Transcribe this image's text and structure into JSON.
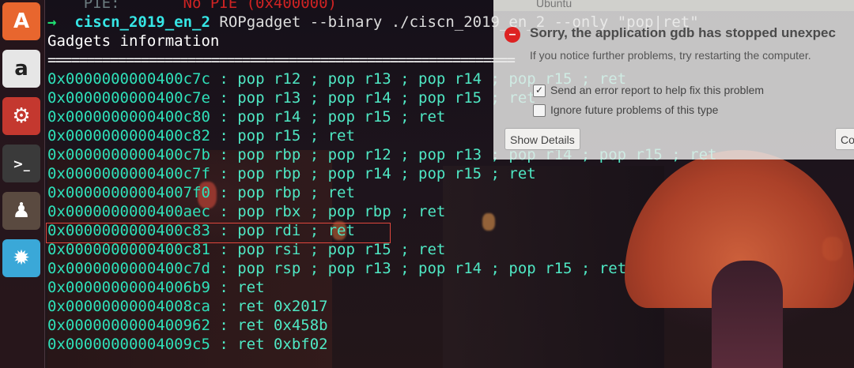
{
  "launcher": {
    "items": [
      {
        "name": "ubuntu-software-center",
        "glyph": "A",
        "color": "#e8662e"
      },
      {
        "name": "amazon",
        "glyph": "a",
        "color": "#e6e6e6"
      },
      {
        "name": "system-settings",
        "glyph": "⚙",
        "color": "#c4382f"
      },
      {
        "name": "terminal",
        "glyph": ">_",
        "color": "#3a3a3a"
      },
      {
        "name": "chess",
        "glyph": "♟",
        "color": "#5a4a40"
      },
      {
        "name": "splash-app",
        "glyph": "✹",
        "color": "#3aa8d8"
      }
    ]
  },
  "terminal": {
    "pie_label": "    PIE:",
    "pie_value": "No PIE (0x400000)",
    "prompt_arrow": "→",
    "prompt_dir": "ciscn_2019_en_2",
    "prompt_cmd": " ROPgadget --binary ./ciscn_2019_en_2 --only \"pop|ret\"",
    "gadgets_header": "Gadgets information",
    "separator": "============================================================",
    "gadgets": [
      {
        "addr": "0x0000000000400c7c",
        "instr": " : pop r12 ; pop r13 ; pop r14 ; pop r15 ; ret"
      },
      {
        "addr": "0x0000000000400c7e",
        "instr": " : pop r13 ; pop r14 ; pop r15 ; ret"
      },
      {
        "addr": "0x0000000000400c80",
        "instr": " : pop r14 ; pop r15 ; ret"
      },
      {
        "addr": "0x0000000000400c82",
        "instr": " : pop r15 ; ret"
      },
      {
        "addr": "0x0000000000400c7b",
        "instr": " : pop rbp ; pop r12 ; pop r13 ; pop r14 ; pop r15 ; ret"
      },
      {
        "addr": "0x0000000000400c7f",
        "instr": " : pop rbp ; pop r14 ; pop r15 ; ret"
      },
      {
        "addr": "0x00000000004007f0",
        "instr": " : pop rbp ; ret"
      },
      {
        "addr": "0x0000000000400aec",
        "instr": " : pop rbx ; pop rbp ; ret"
      },
      {
        "addr": "0x0000000000400c83",
        "instr": " : pop rdi ; ret"
      },
      {
        "addr": "0x0000000000400c81",
        "instr": " : pop rsi ; pop r15 ; ret"
      },
      {
        "addr": "0x0000000000400c7d",
        "instr": " : pop rsp ; pop r13 ; pop r14 ; pop r15 ; ret"
      },
      {
        "addr": "0x00000000004006b9",
        "instr": " : ret"
      },
      {
        "addr": "0x00000000004008ca",
        "instr": " : ret 0x2017"
      },
      {
        "addr": "0x0000000000400962",
        "instr": " : ret 0x458b"
      },
      {
        "addr": "0x00000000004009c5",
        "instr": " : ret 0xbf02"
      }
    ]
  },
  "dialog": {
    "window_title": "Ubuntu",
    "heading": "Sorry, the application gdb has stopped unexpec",
    "subtitle": "If you notice further problems, try restarting the computer.",
    "send_report_label": "Send an error report to help fix this problem",
    "send_report_checked": true,
    "ignore_label": "Ignore future problems of this type",
    "ignore_checked": false,
    "show_details_label": "Show Details",
    "continue_label": "Continue"
  }
}
